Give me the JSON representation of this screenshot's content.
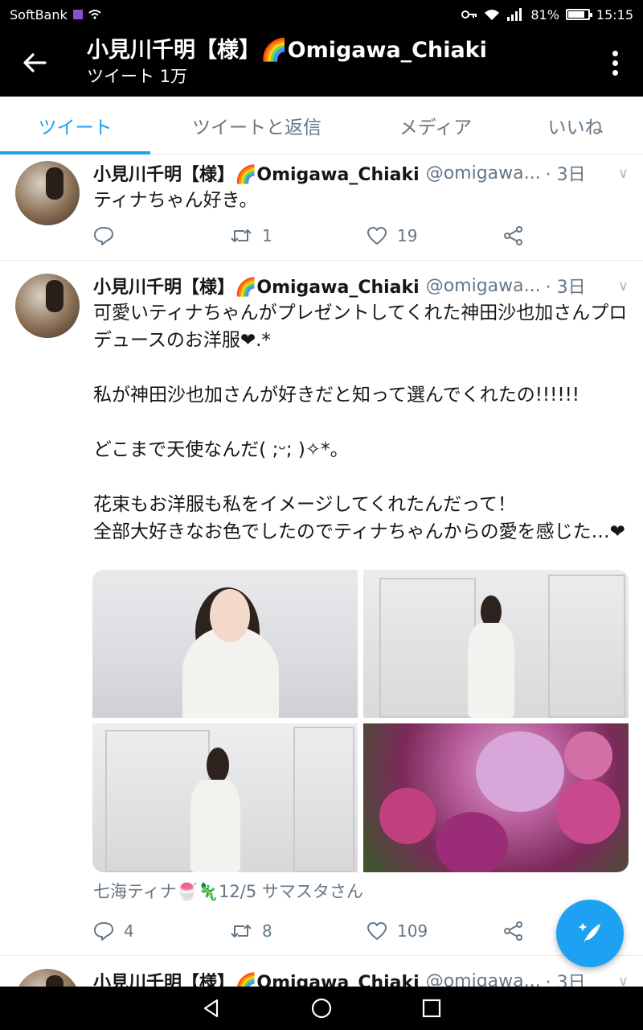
{
  "status_bar": {
    "carrier": "SoftBank",
    "battery": "81%",
    "time": "15:15"
  },
  "header": {
    "title": "小見川千明【様】🌈Omigawa_Chiaki",
    "subtitle": "ツイート 1万"
  },
  "tabs": [
    {
      "label": "ツイート",
      "active": true
    },
    {
      "label": "ツイートと返信",
      "active": false
    },
    {
      "label": "メディア",
      "active": false
    },
    {
      "label": "いいね",
      "active": false
    }
  ],
  "tweets": [
    {
      "name": "小見川千明【様】🌈Omigawa_Chiaki",
      "handle": "@omigawa...",
      "time": "· 3日",
      "text": "ティナちゃん好き。",
      "replies": "",
      "retweets": "1",
      "likes": "19"
    },
    {
      "name": "小見川千明【様】🌈Omigawa_Chiaki",
      "handle": "@omigawa...",
      "time": "· 3日",
      "text": "可愛いティナちゃんがプレゼントしてくれた神田沙也加さんプロデュースのお洋服❤.*\n\n私が神田沙也加さんが好きだと知って選んでくれたの!!!!!!\n\nどこまで天使なんだ( ;ᵕ; )✧*。\n\n花束もお洋服も私をイメージしてくれたんだって！\n全部大好きなお色でしたのでティナちゃんからの愛を感じた…❤",
      "media_caption": "七海ティナ🍧🦎12/5 サマスタさん",
      "replies": "4",
      "retweets": "8",
      "likes": "109"
    },
    {
      "name": "小見川千明【様】🌈Omigawa_Chiaki",
      "handle": "@omigawa...",
      "time": "· 3日"
    }
  ],
  "icons": {
    "back": "arrow-left-icon",
    "more": "more-vertical-icon",
    "reply": "reply-icon",
    "retweet": "retweet-icon",
    "like": "heart-icon",
    "share": "share-icon",
    "compose": "compose-tweet-icon"
  },
  "colors": {
    "accent": "#1da1f2",
    "text_secondary": "#657786",
    "bar_background": "#000000"
  }
}
